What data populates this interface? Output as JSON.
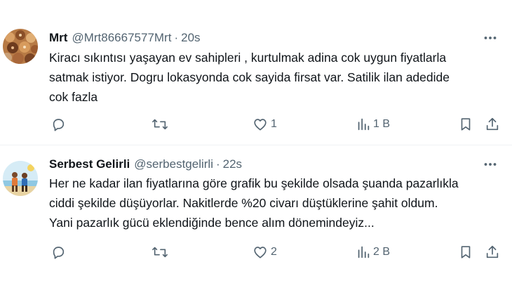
{
  "tweets": [
    {
      "name": "Mrt",
      "handle": "@Mrt86667577Mrt",
      "separator": "·",
      "time": "20s",
      "text_lines": [
        "Kiracı sıkıntısı yaşayan ev sahipleri , kurtulmak adina cok uygun fiyatlarla",
        "satmak istiyor. Dogru lokasyonda cok sayida firsat var. Satilik ilan adedide",
        "cok fazla"
      ],
      "replies": "",
      "retweets": "",
      "likes": "1",
      "views": "1 B"
    },
    {
      "name": "Serbest Gelirli",
      "handle": "@serbestgelirli",
      "separator": "·",
      "time": "22s",
      "text_lines": [
        "Her ne kadar ilan fiyatlarına göre grafik bu şekilde olsada şuanda pazarlıkla",
        "ciddi şekilde düşüyorlar. Nakitlerde %20 civarı düştüklerine şahit oldum.",
        "Yani pazarlık gücü eklendiğinde bence alım dönemindeyiz..."
      ],
      "replies": "",
      "retweets": "",
      "likes": "2",
      "views": "2 B"
    }
  ],
  "icons": {
    "more": "more-horizontal-icon",
    "reply": "reply-icon",
    "retweet": "retweet-icon",
    "like": "heart-icon",
    "views": "views-chart-icon",
    "bookmark": "bookmark-icon",
    "share": "share-icon"
  },
  "colors": {
    "text": "#0f1419",
    "secondary": "#536471",
    "divider": "#eff3f4"
  }
}
